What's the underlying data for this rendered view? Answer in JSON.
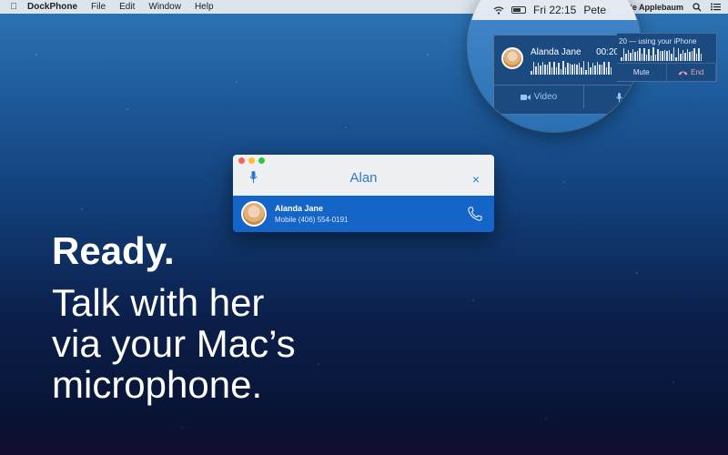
{
  "menubar": {
    "app_name": "DockPhone",
    "items": [
      "File",
      "Edit",
      "Window",
      "Help"
    ],
    "clock": "Fri 22:15",
    "user_truncated": "Pete",
    "user": "Pete Applebaum"
  },
  "call": {
    "name": "Alanda Jane",
    "timer": "00:20",
    "dash": "—",
    "status": "20 — using your iPhone",
    "video_label": "Video",
    "mute_short": "Mut",
    "mute_label": "Mute",
    "end_label": "End"
  },
  "search": {
    "query": "Alan",
    "close": "×",
    "result": {
      "name": "Alanda Jane",
      "phone": "Mobile  (406) 554-0191"
    }
  },
  "headline": {
    "ready": "Ready.",
    "line1": "Talk with her",
    "line2": "via your Mac’s",
    "line3": "microphone."
  },
  "colors": {
    "accent": "#1565c8",
    "end": "#f3a0b5"
  }
}
